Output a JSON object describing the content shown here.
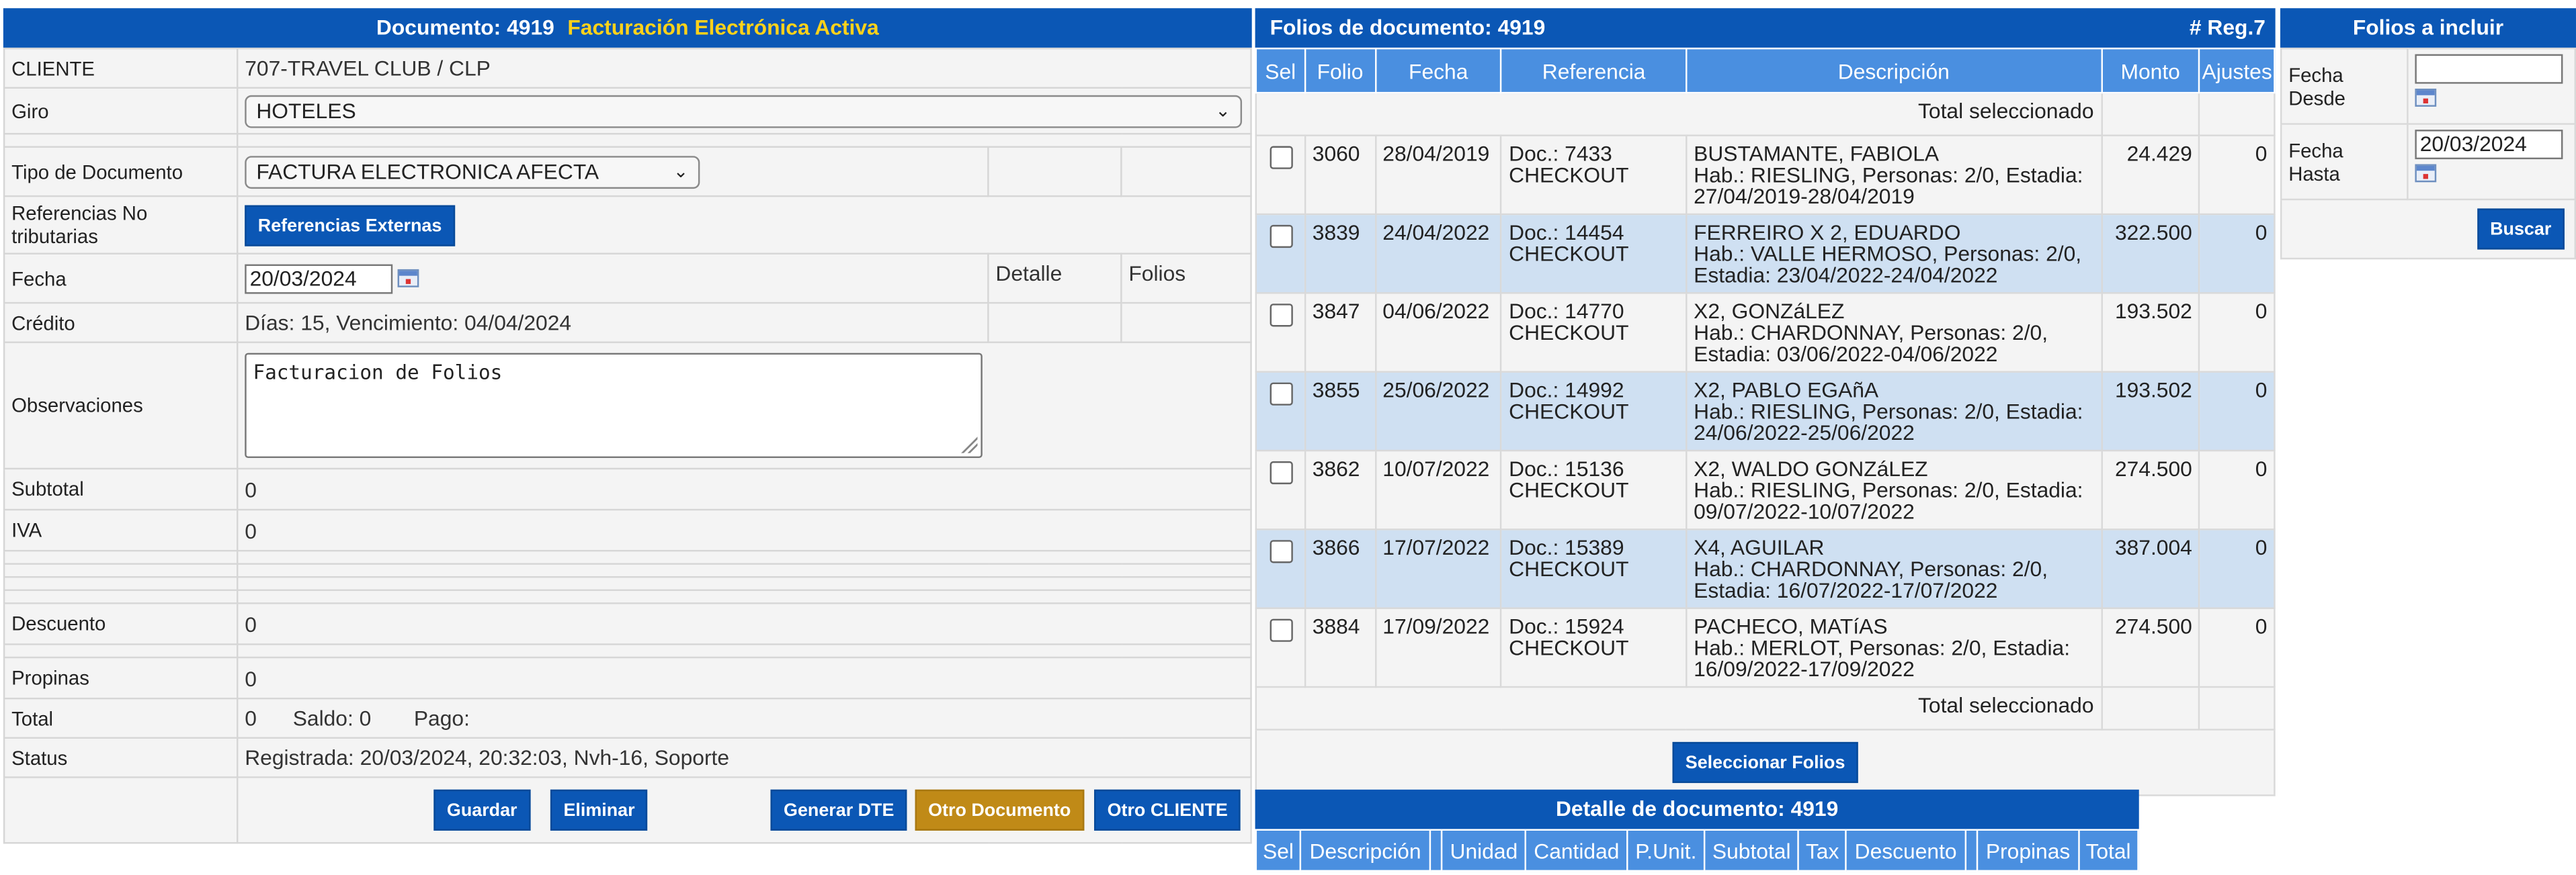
{
  "documento": {
    "header_label": "Documento: 4919",
    "header_active": "Facturación Electrónica Activa",
    "cliente_label": "CLIENTE",
    "cliente_value": "707-TRAVEL CLUB / CLP",
    "giro_label": "Giro",
    "giro_value": "HOTELES",
    "tipo_label": "Tipo de Documento",
    "tipo_value": "FACTURA ELECTRONICA AFECTA",
    "ref_label": "Referencias No tributarias",
    "ref_button": "Referencias Externas",
    "fecha_label": "Fecha",
    "fecha_value": "20/03/2024",
    "detalle_label": "Detalle",
    "folios_label": "Folios",
    "credito_label": "Crédito",
    "credito_value": "Días: 15, Vencimiento: 04/04/2024",
    "obs_label": "Observaciones",
    "obs_value": "Facturacion de Folios",
    "subtotal_label": "Subtotal",
    "subtotal_value": "0",
    "iva_label": "IVA",
    "iva_value": "0",
    "descuento_label": "Descuento",
    "descuento_value": "0",
    "propinas_label": "Propinas",
    "propinas_value": "0",
    "total_label": "Total",
    "total_value": "0",
    "saldo_text": "Saldo: 0",
    "pago_text": "Pago:",
    "status_label": "Status",
    "status_value": "Registrada: 20/03/2024, 20:32:03, Nvh-16, Soporte",
    "buttons": {
      "guardar": "Guardar",
      "eliminar": "Eliminar",
      "generar": "Generar DTE",
      "otro_doc": "Otro Documento",
      "otro_cliente": "Otro CLIENTE"
    }
  },
  "folios": {
    "header_label": "Folios de documento: 4919",
    "reg_label": "# Reg.7",
    "columns": [
      "Sel",
      "Folio",
      "Fecha",
      "Referencia",
      "Descripción",
      "Monto",
      "Ajustes"
    ],
    "total_label": "Total seleccionado",
    "select_button": "Seleccionar Folios",
    "rows": [
      {
        "folio": "3060",
        "fecha": "28/04/2019",
        "ref1": "Doc.: 7433",
        "ref2": "CHECKOUT",
        "desc1": "BUSTAMANTE, FABIOLA",
        "desc2": "Hab.: RIESLING, Personas: 2/0, Estadia:",
        "desc3": "27/04/2019-28/04/2019",
        "monto": "24.429",
        "ajustes": "0"
      },
      {
        "folio": "3839",
        "fecha": "24/04/2022",
        "ref1": "Doc.: 14454",
        "ref2": "CHECKOUT",
        "desc1": "FERREIRO X 2, EDUARDO",
        "desc2": "Hab.: VALLE HERMOSO, Personas: 2/0,",
        "desc3": "Estadia: 23/04/2022-24/04/2022",
        "monto": "322.500",
        "ajustes": "0"
      },
      {
        "folio": "3847",
        "fecha": "04/06/2022",
        "ref1": "Doc.: 14770",
        "ref2": "CHECKOUT",
        "desc1": "X2, GONZáLEZ",
        "desc2": "Hab.: CHARDONNAY, Personas: 2/0,",
        "desc3": "Estadia: 03/06/2022-04/06/2022",
        "monto": "193.502",
        "ajustes": "0"
      },
      {
        "folio": "3855",
        "fecha": "25/06/2022",
        "ref1": "Doc.: 14992",
        "ref2": "CHECKOUT",
        "desc1": "X2, PABLO EGAñA",
        "desc2": "Hab.: RIESLING, Personas: 2/0, Estadia:",
        "desc3": "24/06/2022-25/06/2022",
        "monto": "193.502",
        "ajustes": "0"
      },
      {
        "folio": "3862",
        "fecha": "10/07/2022",
        "ref1": "Doc.: 15136",
        "ref2": "CHECKOUT",
        "desc1": "X2, WALDO GONZáLEZ",
        "desc2": "Hab.: RIESLING, Personas: 2/0, Estadia:",
        "desc3": "09/07/2022-10/07/2022",
        "monto": "274.500",
        "ajustes": "0"
      },
      {
        "folio": "3866",
        "fecha": "17/07/2022",
        "ref1": "Doc.: 15389",
        "ref2": "CHECKOUT",
        "desc1": "X4, AGUILAR",
        "desc2": "Hab.: CHARDONNAY, Personas: 2/0,",
        "desc3": "Estadia: 16/07/2022-17/07/2022",
        "monto": "387.004",
        "ajustes": "0"
      },
      {
        "folio": "3884",
        "fecha": "17/09/2022",
        "ref1": "Doc.: 15924",
        "ref2": "CHECKOUT",
        "desc1": "PACHECO, MATíAS",
        "desc2": "Hab.: MERLOT, Personas: 2/0, Estadia:",
        "desc3": "16/09/2022-17/09/2022",
        "monto": "274.500",
        "ajustes": "0"
      }
    ]
  },
  "detalle": {
    "header_label": "Detalle de documento: 4919",
    "columns": [
      "Sel",
      "Descripción",
      "",
      "Unidad",
      "Cantidad",
      "P.Unit.",
      "Subtotal",
      "Tax",
      "Descuento",
      "",
      "Propinas",
      "Total"
    ]
  },
  "incluir": {
    "header_label": "Folios a incluir",
    "desde_label": "Fecha Desde",
    "desde_value": "",
    "hasta_label": "Fecha Hasta",
    "hasta_value": "20/03/2024",
    "buscar_button": "Buscar"
  }
}
